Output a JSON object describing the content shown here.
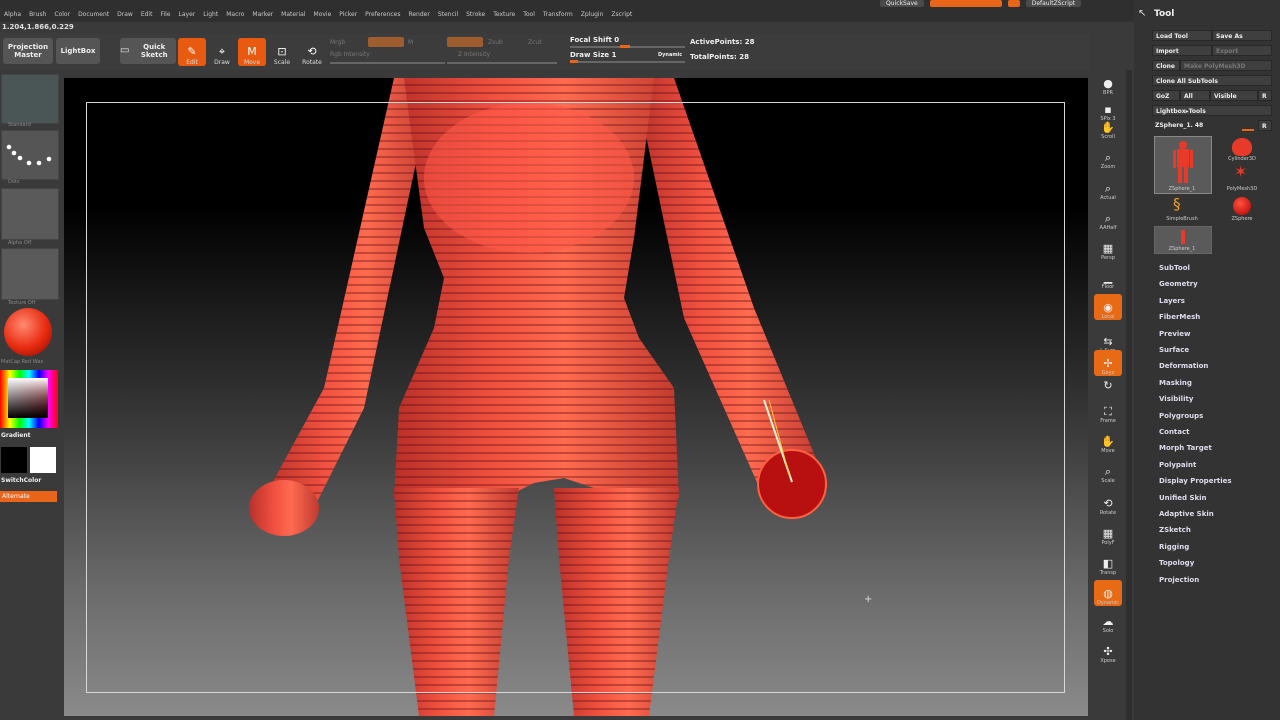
{
  "menu": [
    "Alpha",
    "Brush",
    "Color",
    "Document",
    "Draw",
    "Edit",
    "File",
    "Layer",
    "Light",
    "Macro",
    "Marker",
    "Material",
    "Movie",
    "Picker",
    "Preferences",
    "Render",
    "Stencil",
    "Stroke",
    "Texture",
    "Tool",
    "Transform",
    "Zplugin",
    "Zscript"
  ],
  "coords": "1.204,1.866,0.229",
  "top_right": {
    "quicksave": "QuickSave",
    "default_script": "DefaultZScript"
  },
  "shelf": {
    "projection_master": "Projection Master",
    "lightbox": "LightBox",
    "quick_sketch": "Quick Sketch",
    "edit": "Edit",
    "draw": "Draw",
    "move": "Move",
    "scale": "Scale",
    "rotate": "Rotate",
    "mrgb": "Mrgb",
    "rgb": "Rgb",
    "m": "M",
    "zadd": "Zadd",
    "zsub": "Zsub",
    "zcut": "Zcut",
    "rgb_intensity": "Rgb Intensity",
    "z_intensity": "Z Intensity",
    "focal_shift": "Focal Shift 0",
    "draw_size": "Draw Size 1",
    "dynamic": "Dynamic",
    "active_points": "ActivePoints: 28",
    "total_points": "TotalPoints: 28"
  },
  "left_tray": {
    "brush_label": "Standard",
    "stroke_label": "Dots",
    "alpha_label": "Alpha Off",
    "texture_label": "Texture Off",
    "material_label": "MatCap Red Wax",
    "gradient": "Gradient",
    "switch_color": "SwitchColor",
    "alternate": "Alternate",
    "colors": {
      "primary": "#000000",
      "secondary": "#ffffff",
      "accent": "#e8651a"
    }
  },
  "right_icons": [
    {
      "icon": "bpr-sphere-icon",
      "label": "BPR"
    },
    {
      "icon": "spix-icon",
      "label": "SPix 3"
    },
    {
      "icon": "hand-icon",
      "label": "Scroll"
    },
    {
      "icon": "zoom-icon",
      "label": "Zoom"
    },
    {
      "icon": "actual-icon",
      "label": "Actual"
    },
    {
      "icon": "aahalf-icon",
      "label": "AAHalf"
    },
    {
      "icon": "persp-icon",
      "label": "Persp"
    },
    {
      "icon": "floor-icon",
      "label": "Floor"
    },
    {
      "icon": "local-icon",
      "label": "Local"
    },
    {
      "icon": "lsym-icon",
      "label": "L.Sym"
    },
    {
      "icon": "xyz-icon",
      "label": "Gxyz"
    },
    {
      "icon": "rotate-axis-icon",
      "label": ""
    },
    {
      "icon": "frame-icon",
      "label": "Frame"
    },
    {
      "icon": "move-icon",
      "label": "Move"
    },
    {
      "icon": "scale-icon",
      "label": "Scale"
    },
    {
      "icon": "rotate-icon",
      "label": "Rotate"
    },
    {
      "icon": "polyf-icon",
      "label": "PolyF"
    },
    {
      "icon": "transp-icon",
      "label": "Transp"
    },
    {
      "icon": "ghost-icon",
      "label": "Dynamic"
    },
    {
      "icon": "solo-icon",
      "label": "Solo"
    },
    {
      "icon": "xpose-icon",
      "label": "Xpose"
    }
  ],
  "tool_panel": {
    "title": "Tool",
    "load_tool": "Load Tool",
    "save_as": "Save As",
    "import": "Import",
    "export": "Export",
    "clone": "Clone",
    "make_polymesh": "Make PolyMesh3D",
    "clone_all": "Clone All SubTools",
    "goz": "GoZ",
    "all": "All",
    "visible": "Visible",
    "r": "R",
    "lightbox_tools": "Lightbox▸Tools",
    "current_tool": "ZSphere_1. 48",
    "thumbs": [
      {
        "label": "ZSphere_1"
      },
      {
        "label": "Cylinder3D"
      },
      {
        "label": "PolyMesh3D"
      },
      {
        "label": "SimpleBrush"
      },
      {
        "label": "ZSphere"
      },
      {
        "label": "ZSphere_1"
      }
    ],
    "subpalettes": [
      "SubTool",
      "Geometry",
      "Layers",
      "FiberMesh",
      "Preview",
      "Surface",
      "Deformation",
      "Masking",
      "Visibility",
      "Polygroups",
      "Contact",
      "Morph Target",
      "Polypaint",
      "Display Properties",
      "Unified Skin",
      "Adaptive Skin",
      "ZSketch",
      "Rigging",
      "Topology",
      "Projection"
    ]
  }
}
